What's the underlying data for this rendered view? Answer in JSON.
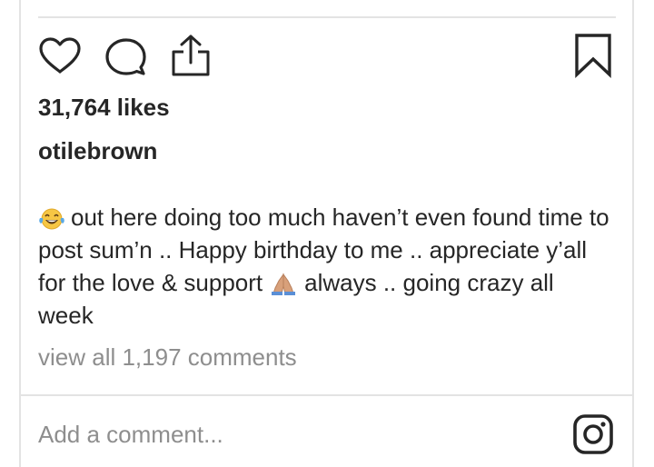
{
  "post": {
    "likes_text": "31,764 likes",
    "username": "otilebrown",
    "caption": {
      "emoji_start": "😂",
      "text_part1": "out here doing too much haven’t even found time to post sum’n .. Happy birthday to me .. appreciate y’all for the love & support",
      "emoji_mid": "🙏🏽",
      "text_part2": "always .. going crazy all week"
    },
    "view_comments_text": "view all 1,197 comments"
  },
  "actions": {
    "like_icon": "heart-icon",
    "comment_icon": "speech-bubble-icon",
    "share_icon": "share-upload-icon",
    "save_icon": "bookmark-icon"
  },
  "comment_box": {
    "placeholder": "Add a comment...",
    "app_icon": "instagram-logo-icon"
  },
  "colors": {
    "text": "#262626",
    "muted": "#8e8e8e",
    "divider": "#e3e3e3"
  }
}
